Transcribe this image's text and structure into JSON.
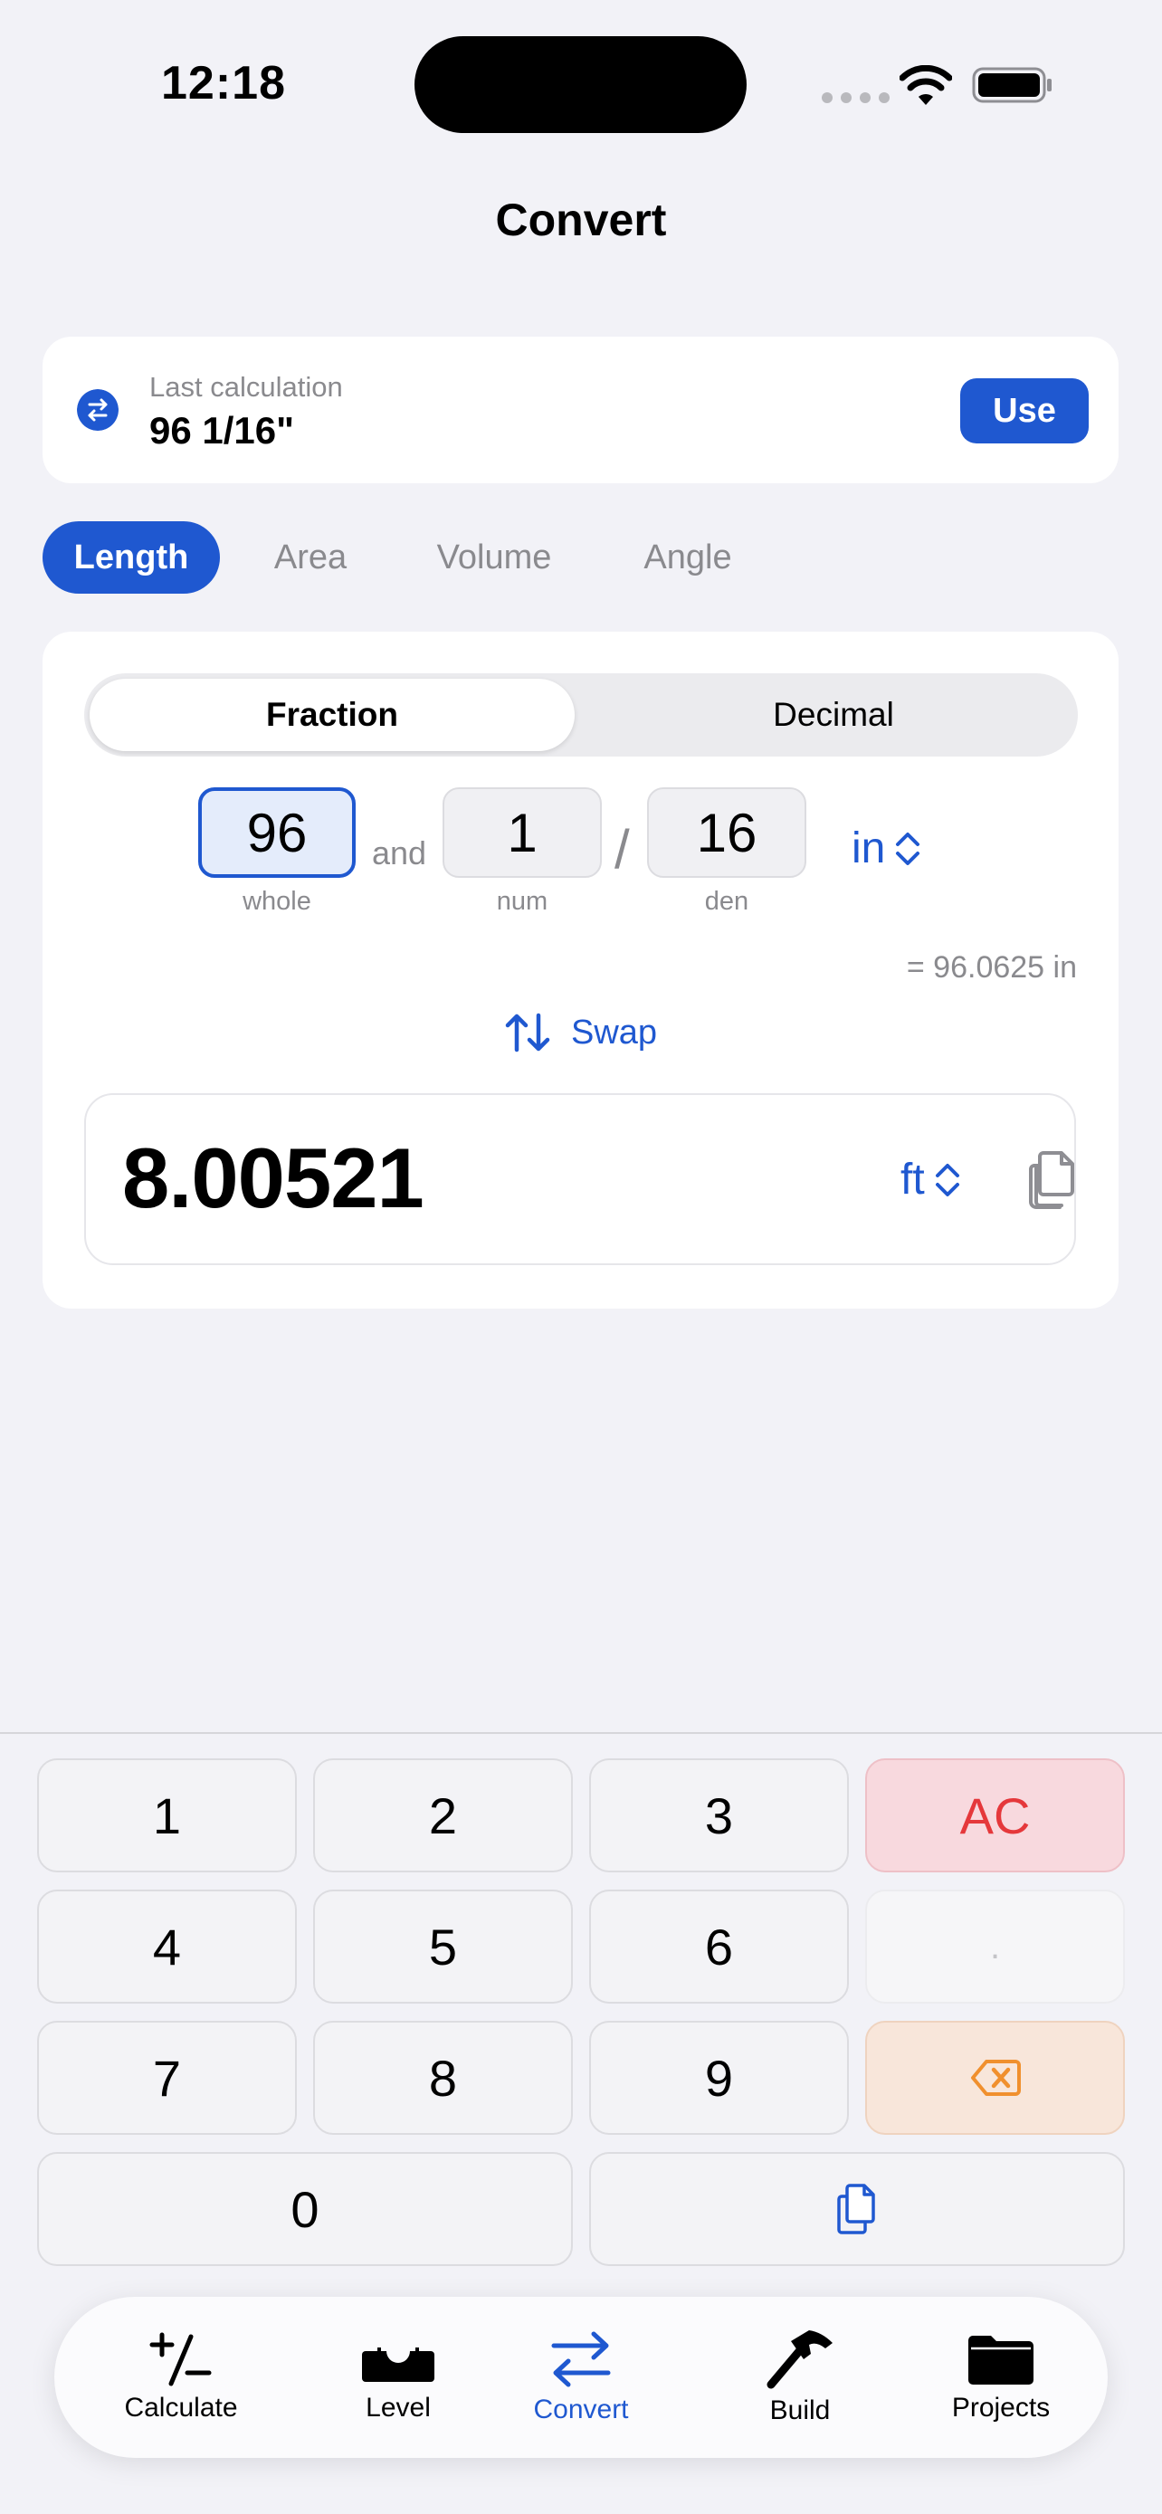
{
  "status": {
    "time": "12:18"
  },
  "page_title": "Convert",
  "last_calculation": {
    "label": "Last calculation",
    "value": "96 1/16\"",
    "use_label": "Use"
  },
  "categories": [
    {
      "label": "Length",
      "active": true
    },
    {
      "label": "Area",
      "active": false
    },
    {
      "label": "Volume",
      "active": false
    },
    {
      "label": "Angle",
      "active": false
    }
  ],
  "mode": {
    "fraction_label": "Fraction",
    "decimal_label": "Decimal",
    "selected": "Fraction"
  },
  "input": {
    "whole": "96",
    "whole_label": "whole",
    "and_label": "and",
    "num": "1",
    "num_label": "num",
    "slash": "/",
    "den": "16",
    "den_label": "den",
    "unit": "in",
    "equivalent": "= 96.0625 in"
  },
  "swap_label": "Swap",
  "result": {
    "value": "8.00521",
    "unit": "ft"
  },
  "keypad": {
    "k1": "1",
    "k2": "2",
    "k3": "3",
    "ac": "AC",
    "k4": "4",
    "k5": "5",
    "k6": "6",
    "dot": ".",
    "k7": "7",
    "k8": "8",
    "k9": "9",
    "k0": "0"
  },
  "tabs": [
    {
      "label": "Calculate",
      "icon": "plus-minus-icon"
    },
    {
      "label": "Level",
      "icon": "level-icon"
    },
    {
      "label": "Convert",
      "icon": "convert-arrows-icon",
      "active": true
    },
    {
      "label": "Build",
      "icon": "hammer-icon"
    },
    {
      "label": "Projects",
      "icon": "folder-icon"
    }
  ],
  "colors": {
    "accent": "#1f58d0",
    "ac_text": "#e5383b",
    "backspace": "#f0902e",
    "background": "#f2f2f7"
  }
}
